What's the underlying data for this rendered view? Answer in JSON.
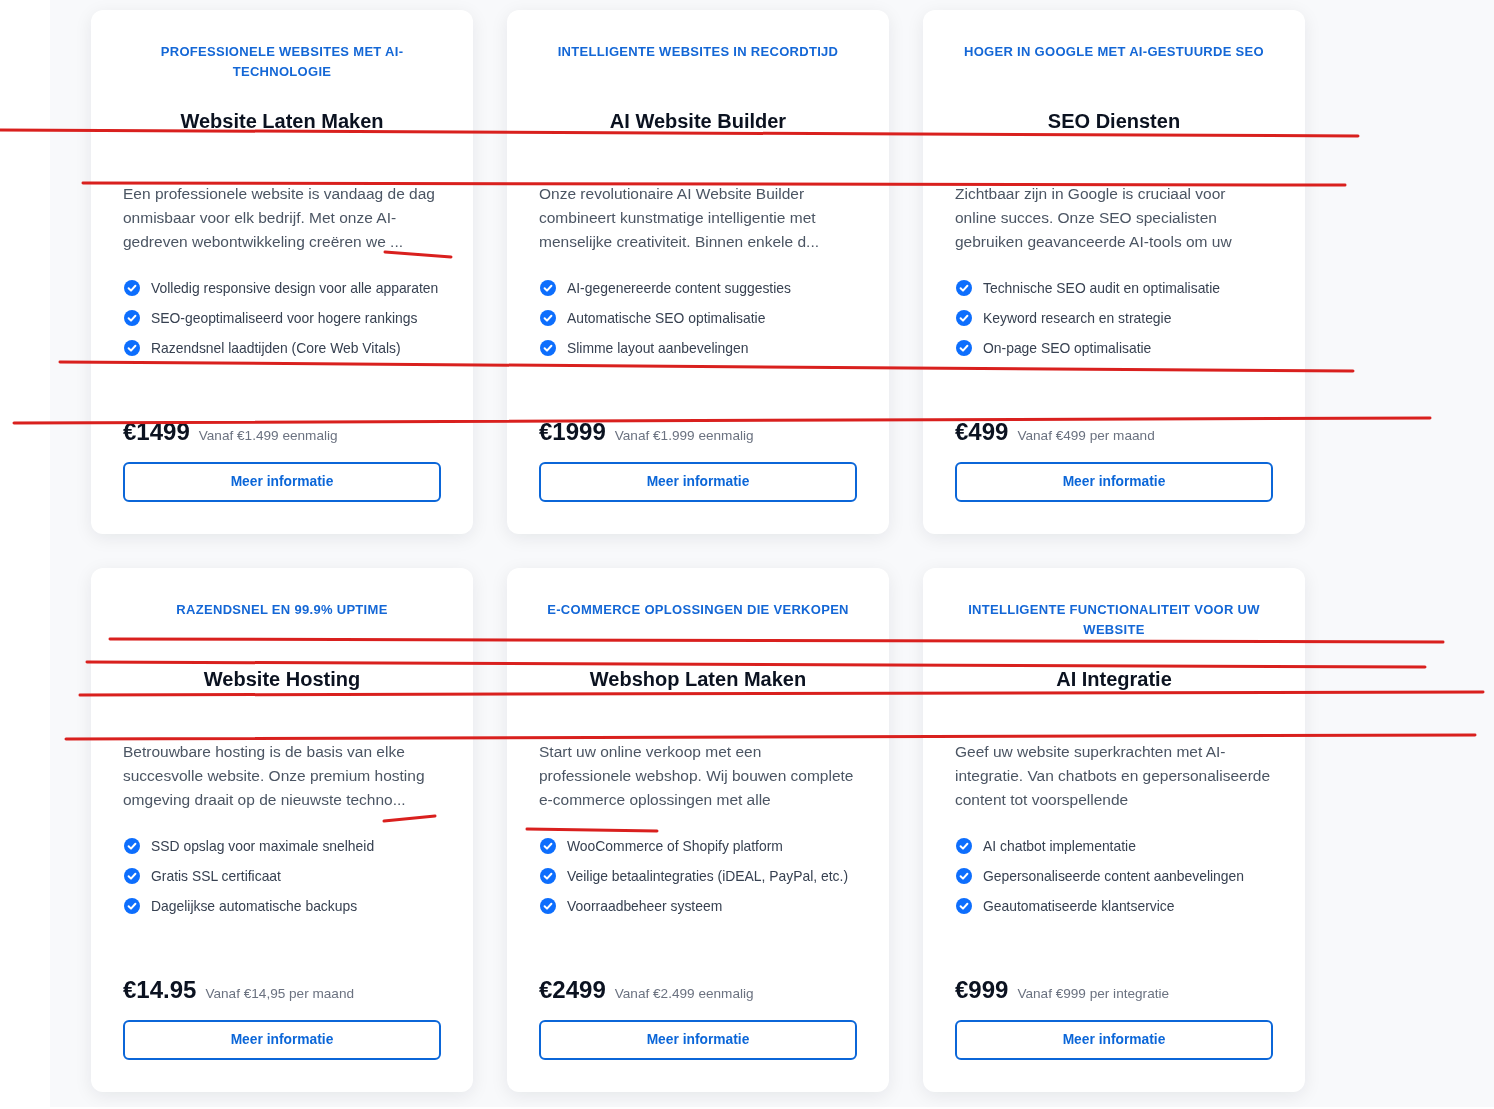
{
  "cards": [
    {
      "tagline": "PROFESSIONELE WEBSITES MET AI-TECHNOLOGIE",
      "title": "Website Laten Maken",
      "description": "Een professionele website is vandaag de dag onmisbaar voor elk bedrijf. Met onze AI-gedreven webontwikkeling creëren we ...",
      "features": [
        "Volledig responsive design voor alle apparaten",
        "SEO-geoptimaliseerd voor hogere rankings",
        "Razendsnel laadtijden (Core Web Vitals)"
      ],
      "price": "€1499",
      "price_note": "Vanaf €1.499 eenmalig",
      "button": "Meer informatie"
    },
    {
      "tagline": "INTELLIGENTE WEBSITES IN RECORDTIJD",
      "title": "AI Website Builder",
      "description": "Onze revolutionaire AI Website Builder combineert kunstmatige intelligentie met menselijke creativiteit. Binnen enkele d...",
      "features": [
        "AI-gegenereerde content suggesties",
        "Automatische SEO optimalisatie",
        "Slimme layout aanbevelingen"
      ],
      "price": "€1999",
      "price_note": "Vanaf €1.999 eenmalig",
      "button": "Meer informatie"
    },
    {
      "tagline": "HOGER IN GOOGLE MET AI-GESTUURDE SEO",
      "title": "SEO Diensten",
      "description": "Zichtbaar zijn in Google is cruciaal voor online succes. Onze SEO specialisten gebruiken geavanceerde AI-tools om uw",
      "features": [
        "Technische SEO audit en optimalisatie",
        "Keyword research en strategie",
        "On-page SEO optimalisatie"
      ],
      "price": "€499",
      "price_note": "Vanaf €499 per maand",
      "button": "Meer informatie"
    },
    {
      "tagline": "RAZENDSNEL EN 99.9% UPTIME",
      "title": "Website Hosting",
      "description": "Betrouwbare hosting is de basis van elke succesvolle website. Onze premium hosting omgeving draait op de nieuwste techno...",
      "features": [
        "SSD opslag voor maximale snelheid",
        "Gratis SSL certificaat",
        "Dagelijkse automatische backups"
      ],
      "price": "€14.95",
      "price_note": "Vanaf €14,95 per maand",
      "button": "Meer informatie"
    },
    {
      "tagline": "E-COMMERCE OPLOSSINGEN DIE VERKOPEN",
      "title": "Webshop Laten Maken",
      "description": "Start uw online verkoop met een professionele webshop. Wij bouwen complete e-commerce oplossingen met alle",
      "features": [
        "WooCommerce of Shopify platform",
        "Veilige betaalintegraties (iDEAL, PayPal, etc.)",
        "Voorraadbeheer systeem"
      ],
      "price": "€2499",
      "price_note": "Vanaf €2.499 eenmalig",
      "button": "Meer informatie"
    },
    {
      "tagline": "INTELLIGENTE FUNCTIONALITEIT VOOR UW WEBSITE",
      "title": "AI Integratie",
      "description": "Geef uw website superkrachten met AI-integratie. Van chatbots en gepersonaliseerde content tot voorspellende",
      "features": [
        "AI chatbot implementatie",
        "Gepersonaliseerde content aanbevelingen",
        "Geautomatiseerde klantservice"
      ],
      "price": "€999",
      "price_note": "Vanaf €999 per integratie",
      "button": "Meer informatie"
    }
  ]
}
